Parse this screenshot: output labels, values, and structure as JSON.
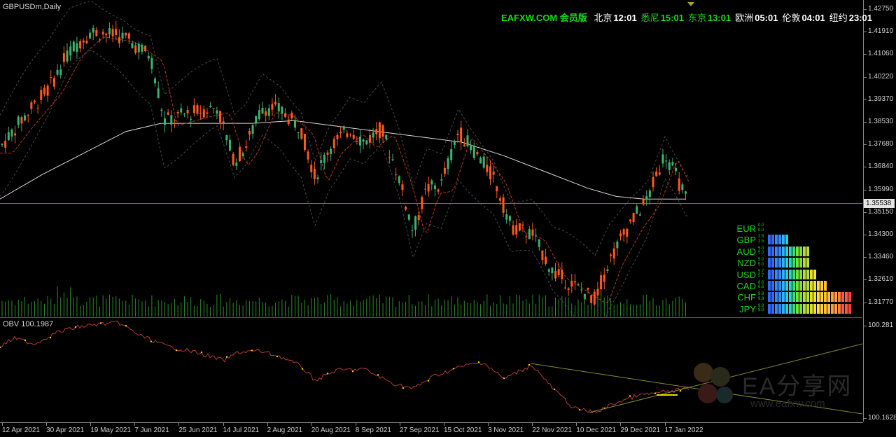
{
  "chart": {
    "symbol_label": "GBPUSDm,Daily",
    "indicator_label": "OBV 100.1987",
    "current_price": "1.35538",
    "price_ticks": [
      "1.42750",
      "1.41910",
      "1.41060",
      "1.40220",
      "1.39370",
      "1.38530",
      "1.37680",
      "1.36840",
      "1.35990",
      "1.35150",
      "1.34300",
      "1.33460",
      "1.32610",
      "1.31770"
    ],
    "obv_ticks": [
      "100.281",
      "100.1628"
    ],
    "date_ticks": [
      "12 Apr 2021",
      "30 Apr 2021",
      "19 May 2021",
      "7 Jun 2021",
      "25 Jun 2021",
      "14 Jul 2021",
      "2 Aug 2021",
      "20 Aug 2021",
      "8 Sep 2021",
      "27 Sep 2021",
      "15 Oct 2021",
      "3 Nov 2021",
      "22 Nov 2021",
      "10 Dec 2021",
      "29 Dec 2021",
      "17 Jan 2022"
    ],
    "colors": {
      "bull": "#3cb371",
      "bear": "#ff5a1f",
      "ma_white": "#d9d9d9",
      "ma_red": "#b23a1a",
      "band": "#4a4a4a",
      "volume": "#2e8b2e",
      "obv": "#b23a3a",
      "hline": "#7a7a20"
    }
  },
  "clock": {
    "brand": "EAFXW.COM 会员版",
    "cities": [
      {
        "label": "北京",
        "time": "12:01",
        "color": "#ffffff"
      },
      {
        "label": "悉尼",
        "time": "15:01",
        "color": "#19d919"
      },
      {
        "label": "东京",
        "time": "13:01",
        "color": "#19d919"
      },
      {
        "label": "欧洲",
        "time": "05:01",
        "color": "#ffffff"
      },
      {
        "label": "伦敦",
        "time": "04:01",
        "color": "#ffffff"
      },
      {
        "label": "纽约",
        "time": "23:01",
        "color": "#ffffff"
      }
    ],
    "brand_color": "#19d919"
  },
  "strength": [
    {
      "code": "EUR",
      "v1": "0.0",
      "v2": "0.0",
      "bars": 0
    },
    {
      "code": "GBP",
      "v1": "2.5",
      "v2": "2.5",
      "bars": 6
    },
    {
      "code": "AUD",
      "v1": "5.0",
      "v2": "5.0",
      "bars": 12
    },
    {
      "code": "NZD",
      "v1": "5.0",
      "v2": "5.0",
      "bars": 12
    },
    {
      "code": "USD",
      "v1": "5.7",
      "v2": "5.7",
      "bars": 14
    },
    {
      "code": "CAD",
      "v1": "6.6",
      "v2": "6.6",
      "bars": 17
    },
    {
      "code": "CHF",
      "v1": "9.9",
      "v2": "9.9",
      "bars": 24
    },
    {
      "code": "JPY",
      "v1": "9.9",
      "v2": "9.9",
      "bars": 24
    }
  ],
  "watermark": {
    "text": "EA分享网",
    "url": "www.eafxw.com"
  }
}
